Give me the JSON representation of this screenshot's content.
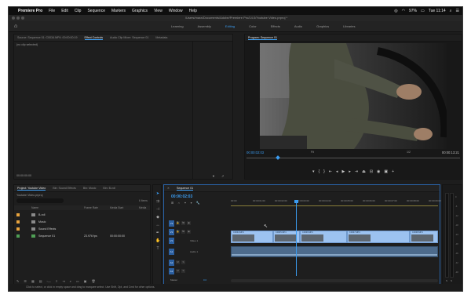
{
  "menubar": {
    "app_name": "Premiere Pro",
    "items": [
      "File",
      "Edit",
      "Clip",
      "Sequence",
      "Markers",
      "Graphics",
      "View",
      "Window",
      "Help"
    ],
    "battery": "97%",
    "time": "Tue 11:14"
  },
  "window": {
    "title": "/Users/mara/Documents/Adobe/Premiere Pro/14.0/Youtube Video.prproj *"
  },
  "workspaces": {
    "tabs": [
      "Learning",
      "Assembly",
      "Editing",
      "Color",
      "Effects",
      "Audio",
      "Graphics",
      "Libraries"
    ],
    "active": "Editing"
  },
  "effect_controls": {
    "tabs": [
      "Source: Sequence 01: C0034.MP4: 00:00:00:19",
      "Effect Controls",
      "Audio Clip Mixer: Sequence 01",
      "Metadata"
    ],
    "active_tab": "Effect Controls",
    "no_clip_text": "(no clip selected)",
    "timecode": "00:00:00:00"
  },
  "program_monitor": {
    "title": "Program: Sequence 01",
    "timecode": "00:00:02:03",
    "fit": "Fit",
    "ratio": "1/2",
    "duration": "00:00:13:21"
  },
  "project": {
    "tabs": [
      "Project: Youtube Video",
      "Bin: Sound Effects",
      "Bin: Music",
      "Bin: B-roll"
    ],
    "active_tab": "Project: Youtube Video",
    "file": "Youtube Video.prproj",
    "items_count": "6 Items",
    "columns": [
      "Name",
      "Frame Rate",
      "Media Start",
      "Media"
    ],
    "rows": [
      {
        "name": "B-roll",
        "frame_rate": "",
        "media_start": "",
        "color": "#e8a33d"
      },
      {
        "name": "Music",
        "frame_rate": "",
        "media_start": "",
        "color": "#e8a33d"
      },
      {
        "name": "Sound Effects",
        "frame_rate": "",
        "media_start": "",
        "color": "#e8a33d"
      },
      {
        "name": "Sequence 01",
        "frame_rate": "23.976 fps",
        "media_start": "00:00:00:00",
        "color": "#4f9f55"
      }
    ]
  },
  "timeline": {
    "title": "Sequence 01",
    "timecode": "00:00:02:03",
    "ruler": [
      "00:00",
      "00:00:01:00",
      "00:00:02:00",
      "00:00:03:00",
      "00:00:04:00",
      "00:00:05:00",
      "00:00:06:00",
      "00:00:07:00",
      "00:00:08:00",
      "00:00:09:00"
    ],
    "tracks": [
      {
        "name": "V3",
        "label": ""
      },
      {
        "name": "V2",
        "label": ""
      },
      {
        "name": "V1",
        "label": "Video 1"
      },
      {
        "name": "A1",
        "label": "Audio 1"
      },
      {
        "name": "A2",
        "label": ""
      },
      {
        "name": "A3",
        "label": ""
      }
    ],
    "clips": [
      "C0034.MP4",
      "C0035.MP4",
      "C0036.MP4",
      "C0037.MP4",
      "C0038.MP4"
    ],
    "master_label": "Master",
    "master_value": "0.0"
  },
  "meters": {
    "scale": [
      "0",
      "-6",
      "-12",
      "-18",
      "-24",
      "-30",
      "-36",
      "-42",
      "-48",
      "-54"
    ],
    "solo_labels": [
      "S",
      "S"
    ]
  },
  "status": {
    "text": "Click to select, or click in empty space and drag to marquee select. Use Shift, Opt, and Cmd for other options."
  }
}
